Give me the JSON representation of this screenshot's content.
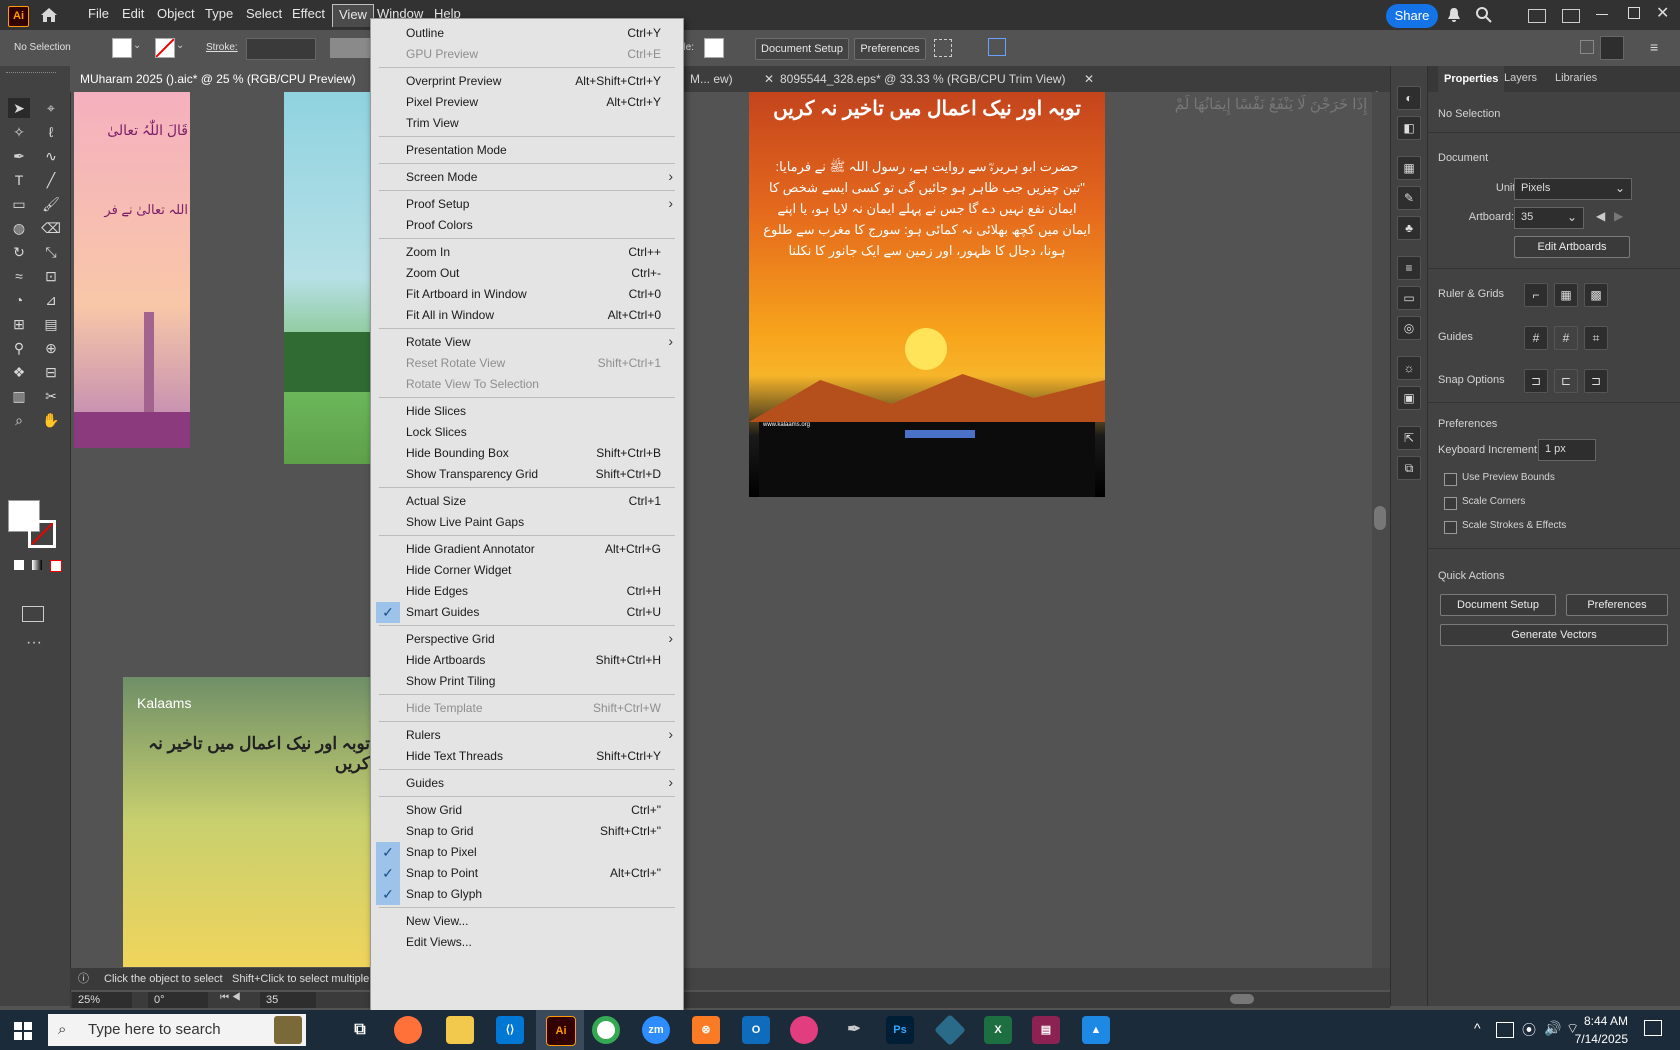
{
  "menubar": {
    "logo": "Ai",
    "items": [
      "File",
      "Edit",
      "Object",
      "Type",
      "Select",
      "Effect",
      "View",
      "Window",
      "Help"
    ],
    "share": "Share"
  },
  "controlbar": {
    "selection": "No Selection",
    "stroke_label": "Stroke:",
    "style_label": "Style:",
    "document_setup": "Document Setup",
    "preferences": "Preferences"
  },
  "tabs": [
    {
      "label": "MUharam 2025 ().aic* @ 25 % (RGB/CPU Preview)"
    },
    {
      "label": "M... ew)"
    },
    {
      "label": "8095544_328.eps* @ 33.33 % (RGB/CPU Trim View)"
    }
  ],
  "view_menu": {
    "items": [
      {
        "label": "Outline",
        "shortcut": "Ctrl+Y"
      },
      {
        "label": "GPU Preview",
        "shortcut": "Ctrl+E",
        "disabled": true
      },
      {
        "sep": true
      },
      {
        "label": "Overprint Preview",
        "shortcut": "Alt+Shift+Ctrl+Y"
      },
      {
        "label": "Pixel Preview",
        "shortcut": "Alt+Ctrl+Y"
      },
      {
        "label": "Trim View",
        "shortcut": ""
      },
      {
        "sep": true
      },
      {
        "label": "Presentation Mode",
        "shortcut": ""
      },
      {
        "sep": true
      },
      {
        "label": "Screen Mode",
        "shortcut": "",
        "submenu": true
      },
      {
        "sep": true
      },
      {
        "label": "Proof Setup",
        "shortcut": "",
        "submenu": true
      },
      {
        "label": "Proof Colors",
        "shortcut": ""
      },
      {
        "sep": true
      },
      {
        "label": "Zoom In",
        "shortcut": "Ctrl++"
      },
      {
        "label": "Zoom Out",
        "shortcut": "Ctrl+-"
      },
      {
        "label": "Fit Artboard in Window",
        "shortcut": "Ctrl+0"
      },
      {
        "label": "Fit All in Window",
        "shortcut": "Alt+Ctrl+0"
      },
      {
        "sep": true
      },
      {
        "label": "Rotate View",
        "shortcut": "",
        "submenu": true
      },
      {
        "label": "Reset Rotate View",
        "shortcut": "Shift+Ctrl+1",
        "disabled": true
      },
      {
        "label": "Rotate View To Selection",
        "shortcut": "",
        "disabled": true
      },
      {
        "sep": true
      },
      {
        "label": "Hide Slices",
        "shortcut": ""
      },
      {
        "label": "Lock Slices",
        "shortcut": ""
      },
      {
        "label": "Hide Bounding Box",
        "shortcut": "Shift+Ctrl+B"
      },
      {
        "label": "Show Transparency Grid",
        "shortcut": "Shift+Ctrl+D"
      },
      {
        "sep": true
      },
      {
        "label": "Actual Size",
        "shortcut": "Ctrl+1"
      },
      {
        "label": "Show Live Paint Gaps",
        "shortcut": ""
      },
      {
        "sep": true
      },
      {
        "label": "Hide Gradient Annotator",
        "shortcut": "Alt+Ctrl+G"
      },
      {
        "label": "Hide Corner Widget",
        "shortcut": ""
      },
      {
        "label": "Hide Edges",
        "shortcut": "Ctrl+H"
      },
      {
        "label": "Smart Guides",
        "shortcut": "Ctrl+U",
        "checked": true
      },
      {
        "sep": true
      },
      {
        "label": "Perspective Grid",
        "shortcut": "",
        "submenu": true
      },
      {
        "label": "Hide Artboards",
        "shortcut": "Shift+Ctrl+H"
      },
      {
        "label": "Show Print Tiling",
        "shortcut": ""
      },
      {
        "sep": true
      },
      {
        "label": "Hide Template",
        "shortcut": "Shift+Ctrl+W",
        "disabled": true
      },
      {
        "sep": true
      },
      {
        "label": "Rulers",
        "shortcut": "",
        "submenu": true
      },
      {
        "label": "Hide Text Threads",
        "shortcut": "Shift+Ctrl+Y"
      },
      {
        "sep": true
      },
      {
        "label": "Guides",
        "shortcut": "",
        "submenu": true
      },
      {
        "sep": true
      },
      {
        "label": "Show Grid",
        "shortcut": "Ctrl+\""
      },
      {
        "label": "Snap to Grid",
        "shortcut": "Shift+Ctrl+\""
      },
      {
        "label": "Snap to Pixel",
        "shortcut": "",
        "checked": true
      },
      {
        "label": "Snap to Point",
        "shortcut": "Alt+Ctrl+\"",
        "checked": true
      },
      {
        "label": "Snap to Glyph",
        "shortcut": "",
        "checked": true
      },
      {
        "sep": true
      },
      {
        "label": "New View...",
        "shortcut": ""
      },
      {
        "label": "Edit Views...",
        "shortcut": ""
      }
    ]
  },
  "properties": {
    "tabs": [
      "Properties",
      "Layers",
      "Libraries"
    ],
    "selection": "No Selection",
    "document": "Document",
    "units_label": "Units:",
    "units_value": "Pixels",
    "artboard_label": "Artboard:",
    "artboard_value": "35",
    "edit_artboards": "Edit Artboards",
    "ruler_grids": "Ruler & Grids",
    "guides": "Guides",
    "snap_options": "Snap Options",
    "preferences": "Preferences",
    "keyboard_increment_label": "Keyboard Increment:",
    "keyboard_increment_value": "1 px",
    "use_preview_bounds": "Use Preview Bounds",
    "scale_corners": "Scale Corners",
    "scale_strokes": "Scale Strokes & Effects",
    "quick_actions": "Quick Actions",
    "document_setup": "Document Setup",
    "preferences_btn": "Preferences",
    "generate_vectors": "Generate Vectors"
  },
  "status": {
    "hint": "Click the object to select",
    "hint2": "Shift+Click to select multiple object",
    "zoom": "25%",
    "rotation": "0°",
    "artboard": "35"
  },
  "artwork": {
    "card_title": "توبہ اور نیک اعمال میں تاخیر نہ کریں",
    "card_body": "حضرت ابو ہریرہؓ سے روایت ہے، رسول اللہ ﷺ نے فرمایا: \"تین چیزیں جب ظاہر ہو جائیں گی تو کسی ایسے شخص کا ایمان نفع نہیں دے گا جس نے پہلے ایمان نہ لایا ہو، یا اپنے ایمان میں کچھ بھلائی نہ کمائی ہو: سورج کا مغرب سے طلوع ہونا، دجال کا ظہور، اور زمین سے ایک جانور کا نکلنا",
    "card_url": "www.kalaams.org",
    "bottom_brand": "Kalaams",
    "bottom_title": "توبہ اور نیک اعمال میں تاخیر نہ کریں",
    "left_card_text1": "قَالَ اللّٰہُ تعالیٰ",
    "left_card_text2": "اللہ تعالیٰ نے فر",
    "arabic_line": "كُلٌّ إِذَا خَرَجْنَ لَا يَنْفَعُ نَفْسًا إِيمَانُهَا لَمْ"
  },
  "taskbar": {
    "search_placeholder": "Type here to search",
    "time": "8:44 AM",
    "date": "7/14/2025"
  }
}
